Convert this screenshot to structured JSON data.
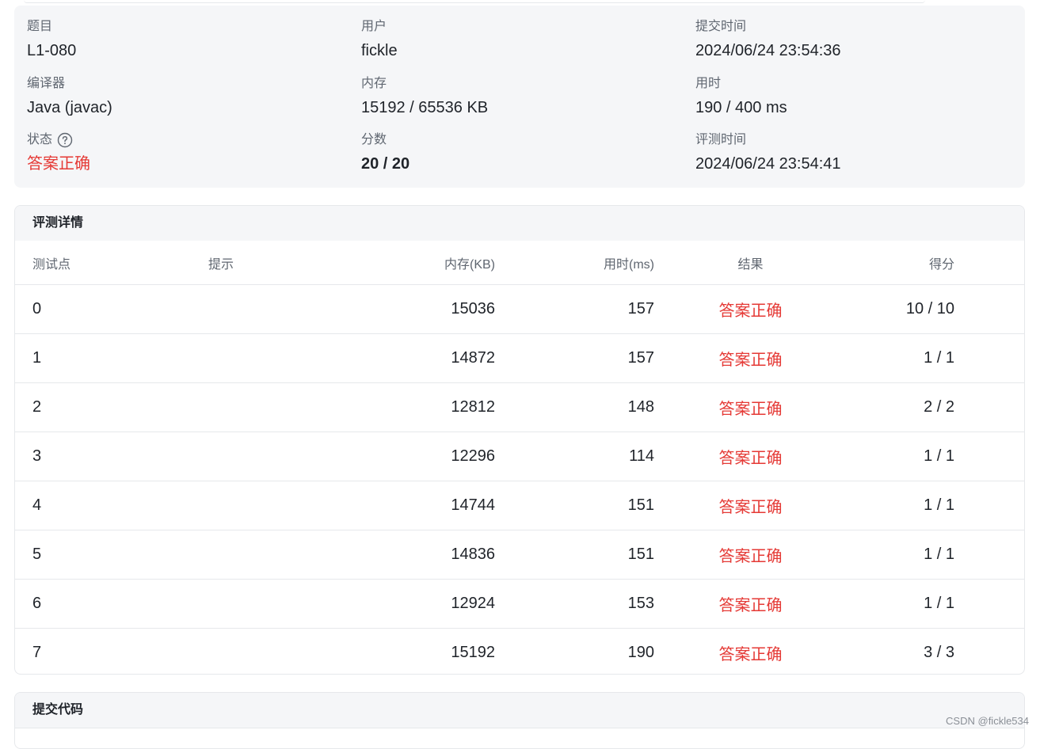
{
  "summary": {
    "problem_label": "题目",
    "problem_value": "L1-080",
    "user_label": "用户",
    "user_value": "fickle",
    "submit_time_label": "提交时间",
    "submit_time_value": "2024/06/24 23:54:36",
    "compiler_label": "编译器",
    "compiler_value": "Java (javac)",
    "memory_label": "内存",
    "memory_value": "15192 / 65536 KB",
    "time_label": "用时",
    "time_value": "190 / 400 ms",
    "status_label": "状态",
    "status_value": "答案正确",
    "score_label": "分数",
    "score_value": "20 / 20",
    "judge_time_label": "评测时间",
    "judge_time_value": "2024/06/24 23:54:41",
    "help_icon": "question-circle-icon",
    "status_color": "#e53935"
  },
  "details": {
    "title": "评测详情",
    "columns": [
      "测试点",
      "提示",
      "内存(KB)",
      "用时(ms)",
      "结果",
      "得分"
    ],
    "rows": [
      {
        "id": "0",
        "hint": "",
        "memory": "15036",
        "time": "157",
        "result": "答案正确",
        "score": "10 / 10"
      },
      {
        "id": "1",
        "hint": "",
        "memory": "14872",
        "time": "157",
        "result": "答案正确",
        "score": "1 / 1"
      },
      {
        "id": "2",
        "hint": "",
        "memory": "12812",
        "time": "148",
        "result": "答案正确",
        "score": "2 / 2"
      },
      {
        "id": "3",
        "hint": "",
        "memory": "12296",
        "time": "114",
        "result": "答案正确",
        "score": "1 / 1"
      },
      {
        "id": "4",
        "hint": "",
        "memory": "14744",
        "time": "151",
        "result": "答案正确",
        "score": "1 / 1"
      },
      {
        "id": "5",
        "hint": "",
        "memory": "14836",
        "time": "151",
        "result": "答案正确",
        "score": "1 / 1"
      },
      {
        "id": "6",
        "hint": "",
        "memory": "12924",
        "time": "153",
        "result": "答案正确",
        "score": "1 / 1"
      },
      {
        "id": "7",
        "hint": "",
        "memory": "15192",
        "time": "190",
        "result": "答案正确",
        "score": "3 / 3"
      }
    ]
  },
  "code_section": {
    "title": "提交代码"
  },
  "watermark": "CSDN @fickle534"
}
